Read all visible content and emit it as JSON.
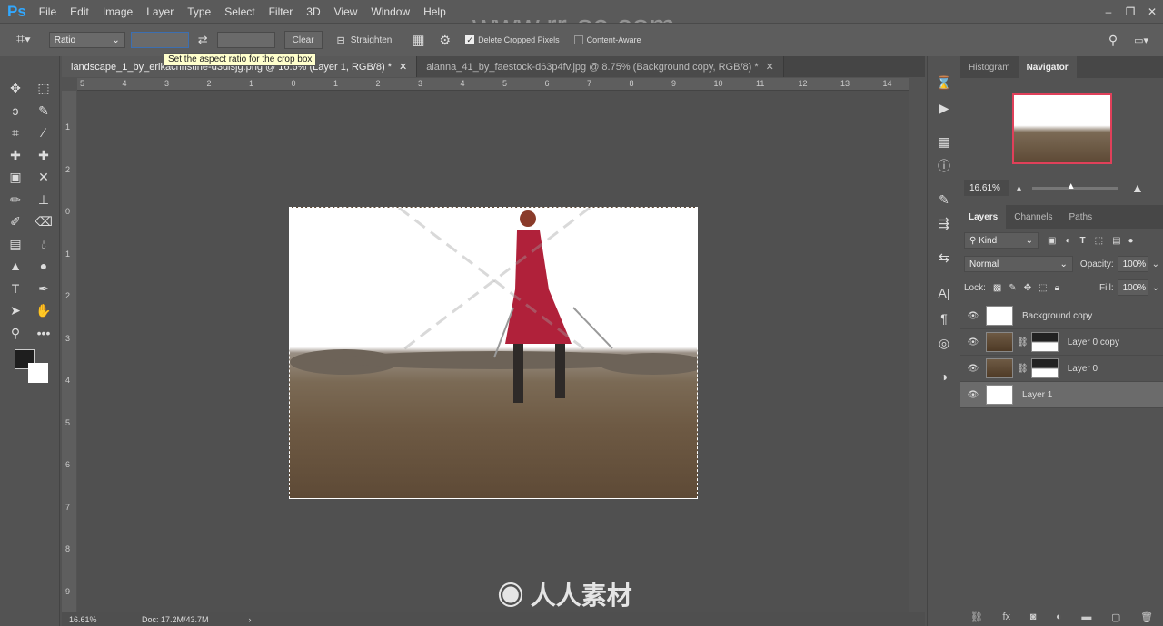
{
  "app": {
    "logo": "Ps",
    "menu": [
      "File",
      "Edit",
      "Image",
      "Layer",
      "Type",
      "Select",
      "Filter",
      "3D",
      "View",
      "Window",
      "Help"
    ]
  },
  "options": {
    "ratio": "Ratio",
    "clear": "Clear",
    "straighten": "Straighten",
    "delete_cropped": "Delete Cropped Pixels",
    "delete_cropped_checked": true,
    "content_aware": "Content-Aware",
    "content_aware_checked": false,
    "tooltip": "Set the aspect ratio for the crop box"
  },
  "tabs": [
    {
      "label": "landscape_1_by_erikachristine-d3dlsjg.png @ 16.6% (Layer 1, RGB/8) *",
      "active": true
    },
    {
      "label": "alanna_41_by_faestock-d63p4fv.jpg @ 8.75% (Background copy, RGB/8) *",
      "active": false
    }
  ],
  "rulers": {
    "h": [
      "5",
      "4",
      "3",
      "2",
      "1",
      "0",
      "1",
      "2",
      "3",
      "4",
      "5",
      "6",
      "7",
      "8",
      "9",
      "10",
      "11",
      "12",
      "13",
      "14"
    ],
    "v": [
      "1",
      "2",
      "0",
      "1",
      "2",
      "3",
      "4",
      "5",
      "6",
      "7",
      "8",
      "9"
    ]
  },
  "status": {
    "zoom": "16.61%",
    "doc": "Doc: 17.2M/43.7M"
  },
  "navigator": {
    "tabs": [
      "Histogram",
      "Navigator"
    ],
    "zoom": "16.61%",
    "zoom_slider": 0.45
  },
  "layers_panel": {
    "tabs": [
      "Layers",
      "Channels",
      "Paths"
    ],
    "kind": "Kind",
    "blend": "Normal",
    "opacity_label": "Opacity:",
    "opacity": "100%",
    "lock_label": "Lock:",
    "fill_label": "Fill:",
    "fill": "100%",
    "layers": [
      {
        "name": "Background copy",
        "mask": false,
        "selected": false
      },
      {
        "name": "Layer 0 copy",
        "mask": true,
        "selected": false
      },
      {
        "name": "Layer 0",
        "mask": true,
        "selected": false
      },
      {
        "name": "Layer 1",
        "mask": false,
        "selected": true
      }
    ]
  },
  "watermark": {
    "url": "www.rr-sc.com",
    "brand": "人人素材"
  },
  "colors": {
    "accent": "#31a8ff",
    "nav_frame": "#e0405a",
    "figure": "#b0213a"
  }
}
